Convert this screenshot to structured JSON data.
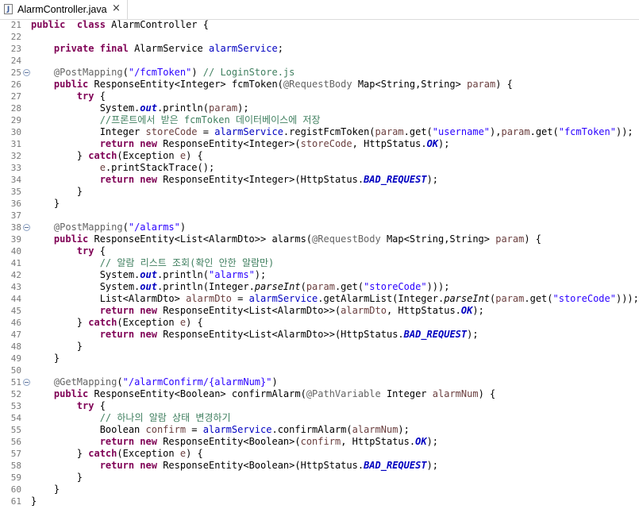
{
  "tab": {
    "title": "AlarmController.java",
    "close": "×",
    "icon": "J"
  },
  "lines": [
    [
      [
        21
      ],
      [
        [
          "k",
          "public"
        ],
        [
          "",
          "  "
        ],
        [
          "k",
          "class"
        ],
        [
          "",
          " AlarmController {"
        ]
      ]
    ],
    [
      [
        22
      ],
      []
    ],
    [
      [
        23
      ],
      [
        [
          "",
          "    "
        ],
        [
          "k",
          "private"
        ],
        [
          "",
          " "
        ],
        [
          "k",
          "final"
        ],
        [
          "",
          " AlarmService "
        ],
        [
          "f",
          "alarmService"
        ],
        [
          "",
          ";"
        ]
      ]
    ],
    [
      [
        24
      ],
      []
    ],
    [
      [
        25
      ],
      [
        [
          "",
          "    "
        ],
        [
          "a",
          "@PostMapping"
        ],
        [
          "",
          "("
        ],
        [
          "s",
          "\"/fcmToken\""
        ],
        [
          ") "
        ],
        [
          "c",
          "// LoginStore.js"
        ]
      ],
      1
    ],
    [
      [
        26
      ],
      [
        [
          "",
          "    "
        ],
        [
          "k",
          "public"
        ],
        [
          "",
          " ResponseEntity<Integer> fcmToken("
        ],
        [
          "a",
          "@RequestBody"
        ],
        [
          "",
          " Map<String,String> "
        ],
        [
          "v",
          "param"
        ],
        [
          "",
          ") {"
        ]
      ]
    ],
    [
      [
        27
      ],
      [
        [
          "",
          "        "
        ],
        [
          "k",
          "try"
        ],
        [
          "",
          " {"
        ]
      ]
    ],
    [
      [
        28
      ],
      [
        [
          "",
          "            System."
        ],
        [
          "fi",
          "out"
        ],
        [
          "",
          ".println("
        ],
        [
          "v",
          "param"
        ],
        [
          "",
          ");"
        ]
      ]
    ],
    [
      [
        29
      ],
      [
        [
          "",
          "            "
        ],
        [
          "c",
          "//프론트에서 받은 fcmToken 데이터베이스에 저장"
        ]
      ]
    ],
    [
      [
        30
      ],
      [
        [
          "",
          "            Integer "
        ],
        [
          "v",
          "storeCode"
        ],
        [
          "",
          " = "
        ],
        [
          "f",
          "alarmService"
        ],
        [
          "",
          ".registFcmToken("
        ],
        [
          "v",
          "param"
        ],
        [
          "",
          ".get("
        ],
        [
          "s",
          "\"username\""
        ],
        [
          "",
          "),"
        ],
        [
          "v",
          "param"
        ],
        [
          "",
          ".get("
        ],
        [
          "s",
          "\"fcmToken\""
        ],
        [
          "",
          "));"
        ]
      ]
    ],
    [
      [
        31
      ],
      [
        [
          "",
          "            "
        ],
        [
          "k",
          "return"
        ],
        [
          "",
          " "
        ],
        [
          "k",
          "new"
        ],
        [
          "",
          " ResponseEntity<Integer>("
        ],
        [
          "v",
          "storeCode"
        ],
        [
          "",
          ", HttpStatus."
        ],
        [
          "fi",
          "OK"
        ],
        [
          "",
          ");"
        ]
      ]
    ],
    [
      [
        32
      ],
      [
        [
          "",
          "        } "
        ],
        [
          "k",
          "catch"
        ],
        [
          "",
          "(Exception "
        ],
        [
          "v",
          "e"
        ],
        [
          "",
          ") {"
        ]
      ]
    ],
    [
      [
        33
      ],
      [
        [
          "",
          "            "
        ],
        [
          "v",
          "e"
        ],
        [
          "",
          ".printStackTrace();"
        ]
      ]
    ],
    [
      [
        34
      ],
      [
        [
          "",
          "            "
        ],
        [
          "k",
          "return"
        ],
        [
          "",
          " "
        ],
        [
          "k",
          "new"
        ],
        [
          "",
          " ResponseEntity<Integer>(HttpStatus."
        ],
        [
          "fi",
          "BAD_REQUEST"
        ],
        [
          "",
          ");"
        ]
      ]
    ],
    [
      [
        35
      ],
      [
        [
          "",
          "        }"
        ]
      ]
    ],
    [
      [
        36
      ],
      [
        [
          "",
          "    }"
        ]
      ]
    ],
    [
      [
        37
      ],
      []
    ],
    [
      [
        38
      ],
      [
        [
          "",
          "    "
        ],
        [
          "a",
          "@PostMapping"
        ],
        [
          "",
          "("
        ],
        [
          "s",
          "\"/alarms\""
        ],
        [
          "",
          ")"
        ]
      ],
      1
    ],
    [
      [
        39
      ],
      [
        [
          "",
          "    "
        ],
        [
          "k",
          "public"
        ],
        [
          "",
          " ResponseEntity<List<AlarmDto>> alarms("
        ],
        [
          "a",
          "@RequestBody"
        ],
        [
          "",
          " Map<String,String> "
        ],
        [
          "v",
          "param"
        ],
        [
          "",
          ") {"
        ]
      ]
    ],
    [
      [
        40
      ],
      [
        [
          "",
          "        "
        ],
        [
          "k",
          "try"
        ],
        [
          "",
          " {"
        ]
      ]
    ],
    [
      [
        41
      ],
      [
        [
          "",
          "            "
        ],
        [
          "c",
          "// 알람 리스트 조회(확인 안한 알람만)"
        ]
      ]
    ],
    [
      [
        42
      ],
      [
        [
          "",
          "            System."
        ],
        [
          "fi",
          "out"
        ],
        [
          "",
          ".println("
        ],
        [
          "s",
          "\"alarms\""
        ],
        [
          "",
          ");"
        ]
      ]
    ],
    [
      [
        43
      ],
      [
        [
          "",
          "            System."
        ],
        [
          "fi",
          "out"
        ],
        [
          "",
          ".println(Integer."
        ],
        [
          "st",
          "parseInt"
        ],
        [
          "",
          "("
        ],
        [
          "v",
          "param"
        ],
        [
          "",
          ".get("
        ],
        [
          "s",
          "\"storeCode\""
        ],
        [
          "",
          ")));"
        ]
      ]
    ],
    [
      [
        44
      ],
      [
        [
          "",
          "            List<AlarmDto> "
        ],
        [
          "v",
          "alarmDto"
        ],
        [
          "",
          " = "
        ],
        [
          "f",
          "alarmService"
        ],
        [
          "",
          ".getAlarmList(Integer."
        ],
        [
          "st",
          "parseInt"
        ],
        [
          "",
          "("
        ],
        [
          "v",
          "param"
        ],
        [
          "",
          ".get("
        ],
        [
          "s",
          "\"storeCode\""
        ],
        [
          "",
          ")));"
        ]
      ]
    ],
    [
      [
        45
      ],
      [
        [
          "",
          "            "
        ],
        [
          "k",
          "return"
        ],
        [
          "",
          " "
        ],
        [
          "k",
          "new"
        ],
        [
          "",
          " ResponseEntity<List<AlarmDto>>("
        ],
        [
          "v",
          "alarmDto"
        ],
        [
          "",
          ", HttpStatus."
        ],
        [
          "fi",
          "OK"
        ],
        [
          "",
          ");"
        ]
      ]
    ],
    [
      [
        46
      ],
      [
        [
          "",
          "        } "
        ],
        [
          "k",
          "catch"
        ],
        [
          "",
          "(Exception "
        ],
        [
          "v",
          "e"
        ],
        [
          "",
          ") {"
        ]
      ]
    ],
    [
      [
        47
      ],
      [
        [
          "",
          "            "
        ],
        [
          "k",
          "return"
        ],
        [
          "",
          " "
        ],
        [
          "k",
          "new"
        ],
        [
          "",
          " ResponseEntity<List<AlarmDto>>(HttpStatus."
        ],
        [
          "fi",
          "BAD_REQUEST"
        ],
        [
          "",
          ");"
        ]
      ]
    ],
    [
      [
        48
      ],
      [
        [
          "",
          "        }"
        ]
      ]
    ],
    [
      [
        49
      ],
      [
        [
          "",
          "    }"
        ]
      ]
    ],
    [
      [
        50
      ],
      []
    ],
    [
      [
        51
      ],
      [
        [
          "",
          "    "
        ],
        [
          "a",
          "@GetMapping"
        ],
        [
          "",
          "("
        ],
        [
          "s",
          "\"/alarmConfirm/{alarmNum}\""
        ],
        [
          "",
          ")"
        ]
      ],
      1
    ],
    [
      [
        52
      ],
      [
        [
          "",
          "    "
        ],
        [
          "k",
          "public"
        ],
        [
          "",
          " ResponseEntity<Boolean> confirmAlarm("
        ],
        [
          "a",
          "@PathVariable"
        ],
        [
          "",
          " Integer "
        ],
        [
          "v",
          "alarmNum"
        ],
        [
          "",
          ") {"
        ]
      ]
    ],
    [
      [
        53
      ],
      [
        [
          "",
          "        "
        ],
        [
          "k",
          "try"
        ],
        [
          "",
          " {"
        ]
      ]
    ],
    [
      [
        54
      ],
      [
        [
          "",
          "            "
        ],
        [
          "c",
          "// 하나의 알람 상태 변경하기"
        ]
      ]
    ],
    [
      [
        55
      ],
      [
        [
          "",
          "            Boolean "
        ],
        [
          "v",
          "confirm"
        ],
        [
          "",
          " = "
        ],
        [
          "f",
          "alarmService"
        ],
        [
          "",
          ".confirmAlarm("
        ],
        [
          "v",
          "alarmNum"
        ],
        [
          "",
          ");"
        ]
      ]
    ],
    [
      [
        56
      ],
      [
        [
          "",
          "            "
        ],
        [
          "k",
          "return"
        ],
        [
          "",
          " "
        ],
        [
          "k",
          "new"
        ],
        [
          "",
          " ResponseEntity<Boolean>("
        ],
        [
          "v",
          "confirm"
        ],
        [
          "",
          ", HttpStatus."
        ],
        [
          "fi",
          "OK"
        ],
        [
          "",
          ");"
        ]
      ]
    ],
    [
      [
        57
      ],
      [
        [
          "",
          "        } "
        ],
        [
          "k",
          "catch"
        ],
        [
          "",
          "(Exception "
        ],
        [
          "v",
          "e"
        ],
        [
          "",
          ") {"
        ]
      ]
    ],
    [
      [
        58
      ],
      [
        [
          "",
          "            "
        ],
        [
          "k",
          "return"
        ],
        [
          "",
          " "
        ],
        [
          "k",
          "new"
        ],
        [
          "",
          " ResponseEntity<Boolean>(HttpStatus."
        ],
        [
          "fi",
          "BAD_REQUEST"
        ],
        [
          "",
          ");"
        ]
      ]
    ],
    [
      [
        59
      ],
      [
        [
          "",
          "        }"
        ]
      ]
    ],
    [
      [
        60
      ],
      [
        [
          "",
          "    }"
        ]
      ]
    ],
    [
      [
        61
      ],
      [
        [
          "",
          "}"
        ]
      ]
    ]
  ]
}
